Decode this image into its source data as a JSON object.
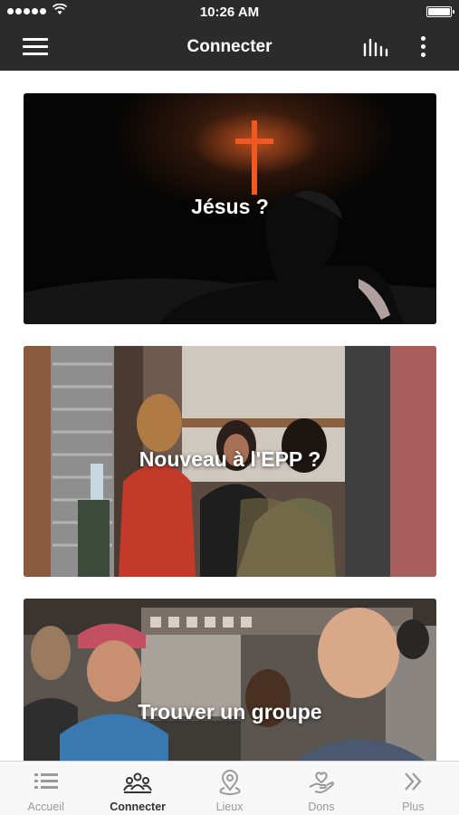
{
  "status_bar": {
    "time": "10:26 AM"
  },
  "header": {
    "title": "Connecter"
  },
  "cards": [
    {
      "title": "Jésus ?"
    },
    {
      "title": "Nouveau à l'EPP ?"
    },
    {
      "title": "Trouver un groupe"
    }
  ],
  "tabs": [
    {
      "label": "Accueil",
      "icon": "list-icon",
      "active": false
    },
    {
      "label": "Connecter",
      "icon": "people-group-icon",
      "active": true
    },
    {
      "label": "Lieux",
      "icon": "map-pin-icon",
      "active": false
    },
    {
      "label": "Dons",
      "icon": "heart-hand-icon",
      "active": false
    },
    {
      "label": "Plus",
      "icon": "double-chevron-right-icon",
      "active": false
    }
  ],
  "colors": {
    "bar_background": "#2b2b2b",
    "tab_active": "#333333",
    "tab_inactive": "#9a9a9a",
    "cross_accent": "#e8521f"
  }
}
